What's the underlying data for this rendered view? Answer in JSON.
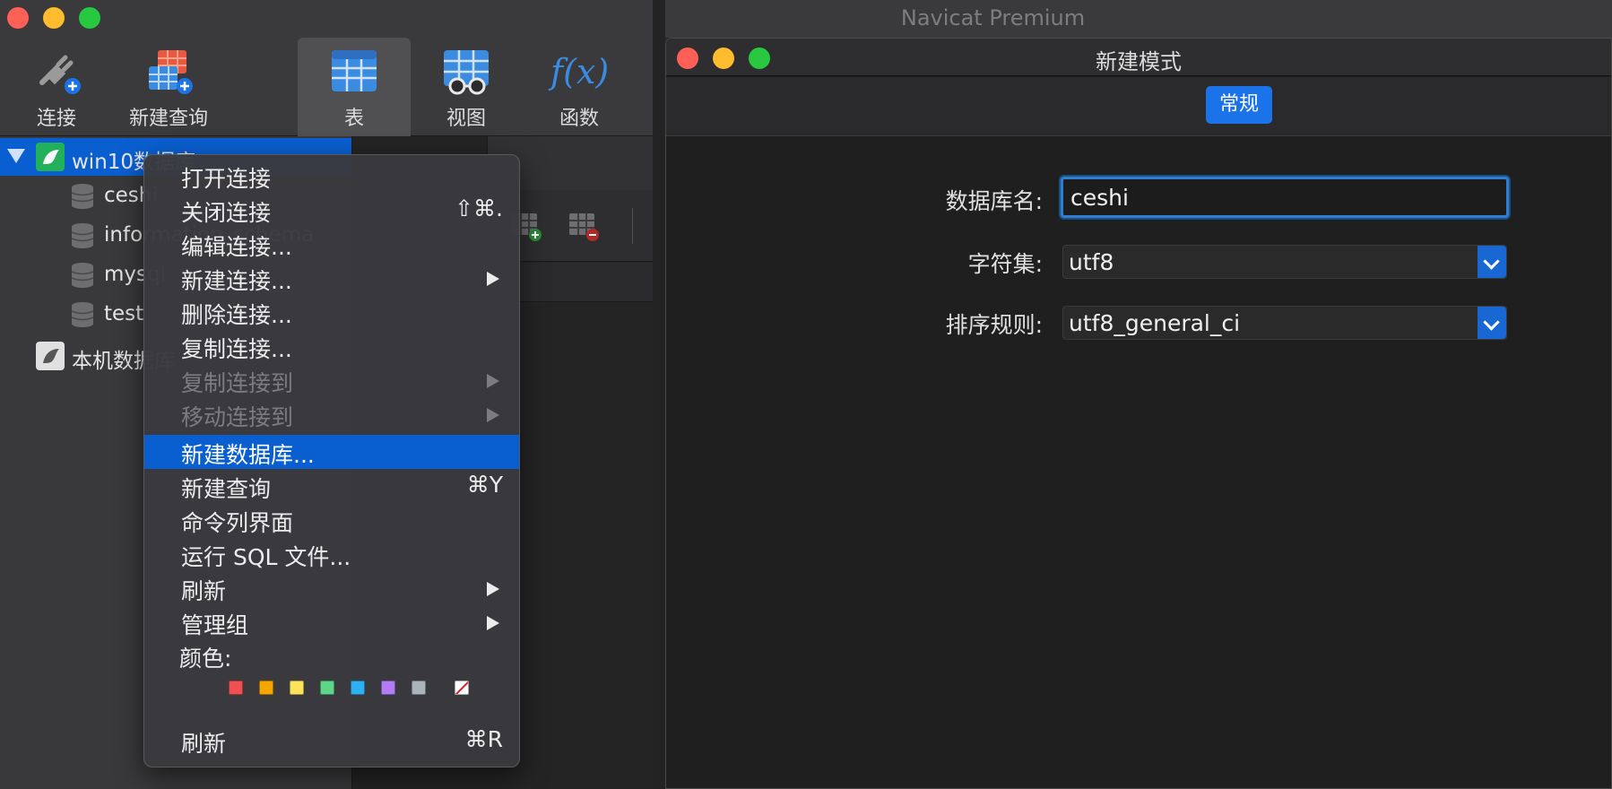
{
  "app": {
    "title": "Navicat Premium"
  },
  "toolbar": {
    "items": [
      {
        "label": "连接",
        "icon": "connection-plug-icon"
      },
      {
        "label": "新建查询",
        "icon": "new-query-icon"
      },
      {
        "label": "表",
        "icon": "table-icon",
        "selected": true
      },
      {
        "label": "视图",
        "icon": "view-icon"
      },
      {
        "label": "函数",
        "icon": "function-icon",
        "glyph": "f(x)"
      }
    ]
  },
  "sidebar": {
    "connections": [
      {
        "label": "win10数据库",
        "expanded": true,
        "selected": true
      },
      {
        "label": "本机数据库"
      }
    ],
    "databases": [
      "ceshi",
      "information_schema",
      "mysql",
      "test"
    ]
  },
  "context_menu": {
    "items": [
      {
        "label": "打开连接"
      },
      {
        "label": "关闭连接",
        "shortcut": "⇧⌘."
      },
      {
        "label": "编辑连接..."
      },
      {
        "label": "新建连接...",
        "submenu": true
      },
      {
        "label": "删除连接..."
      },
      {
        "label": "复制连接..."
      },
      {
        "label": "复制连接到",
        "submenu": true,
        "disabled": true
      },
      {
        "label": "移动连接到",
        "submenu": true,
        "disabled": true
      },
      {
        "label": "新建数据库...",
        "highlighted": true
      },
      {
        "label": "新建查询",
        "shortcut": "⌘Y"
      },
      {
        "label": "命令列界面"
      },
      {
        "label": "运行 SQL 文件..."
      },
      {
        "label": "刷新",
        "submenu": true
      },
      {
        "label": "管理组",
        "submenu": true
      }
    ],
    "color_label": "颜色:",
    "colors": [
      "#f0504f",
      "#f7a600",
      "#fbe35c",
      "#5ed68a",
      "#2fb0f0",
      "#b27cf5",
      "#a9b4bd",
      "none"
    ],
    "refresh_label": "刷新",
    "refresh_shortcut": "⌘R"
  },
  "dialog": {
    "title": "新建模式",
    "tab_general": "常规",
    "db_name_label": "数据库名:",
    "db_name_value": "ceshi",
    "charset_label": "字符集:",
    "charset_value": "utf8",
    "collation_label": "排序规则:",
    "collation_value": "utf8_general_ci"
  }
}
